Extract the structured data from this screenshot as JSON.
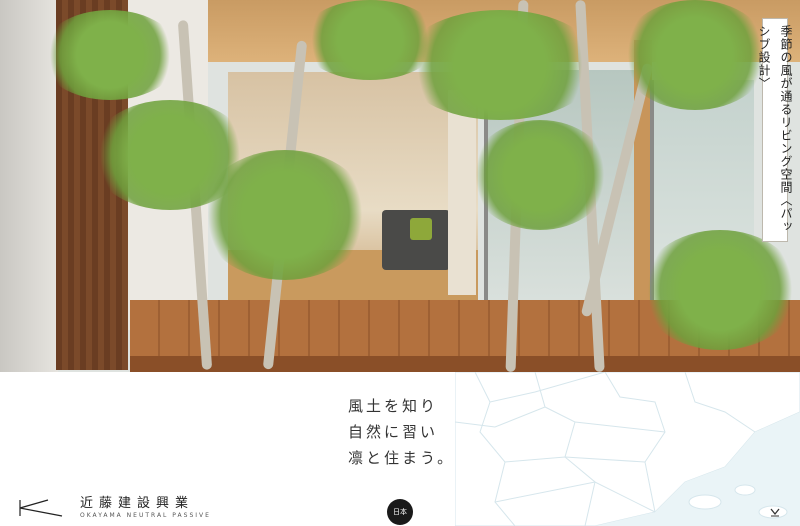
{
  "hero": {
    "image_alt_icon": "house-photo",
    "caption": "季節の風が通るリビング空間〈パッシブ設計〉"
  },
  "tagline": {
    "lines": [
      "風土を知り",
      "自然に習い",
      "凛と住まう。"
    ]
  },
  "brand": {
    "name": "近藤建設興業",
    "sub": "OKAYAMA NEUTRAL PASSIVE",
    "logo_icon": "k-logo-icon"
  },
  "language_button": {
    "label": "日本"
  },
  "scroll_button": {
    "icon": "down-arrow-icon"
  },
  "colors": {
    "map_sea": "#eef6f8",
    "map_land": "#ffffff",
    "map_lines": "#cfe0e6",
    "deck": "#b3713e",
    "button_bg": "#1a1a1a"
  }
}
